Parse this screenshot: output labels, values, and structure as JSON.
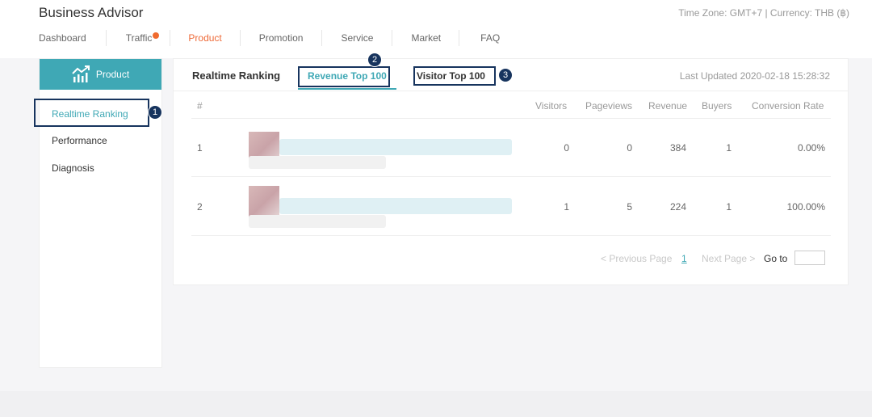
{
  "app": {
    "title": "Business Advisor",
    "timezone": "Time Zone: GMT+7 | Currency: THB (฿)"
  },
  "nav": [
    {
      "label": "Dashboard"
    },
    {
      "label": "Traffic"
    },
    {
      "label": "Product"
    },
    {
      "label": "Promotion"
    },
    {
      "label": "Service"
    },
    {
      "label": "Market"
    },
    {
      "label": "FAQ"
    }
  ],
  "sidebar": {
    "header": "Product",
    "items": [
      {
        "label": "Realtime Ranking"
      },
      {
        "label": "Performance"
      },
      {
        "label": "Diagnosis"
      }
    ]
  },
  "panel": {
    "tabs": [
      {
        "label": "Realtime Ranking"
      },
      {
        "label": "Revenue Top 100"
      },
      {
        "label": "Visitor Top 100"
      }
    ],
    "last_updated": "Last Updated 2020-02-18 15:28:32"
  },
  "table": {
    "headers": [
      "#",
      "Visitors",
      "Pageviews",
      "Revenue",
      "Buyers",
      "Conversion Rate"
    ],
    "rows": [
      {
        "rank": "1",
        "visitors": "0",
        "pageviews": "0",
        "revenue": "384",
        "buyers": "1",
        "conversion": "0.00%"
      },
      {
        "rank": "2",
        "visitors": "1",
        "pageviews": "5",
        "revenue": "224",
        "buyers": "1",
        "conversion": "100.00%"
      }
    ]
  },
  "pagination": {
    "prev": "< Previous Page",
    "current": "1",
    "next": "Next Page >",
    "goto": "Go to"
  },
  "annotations": {
    "one": "1",
    "two": "2",
    "three": "3"
  }
}
